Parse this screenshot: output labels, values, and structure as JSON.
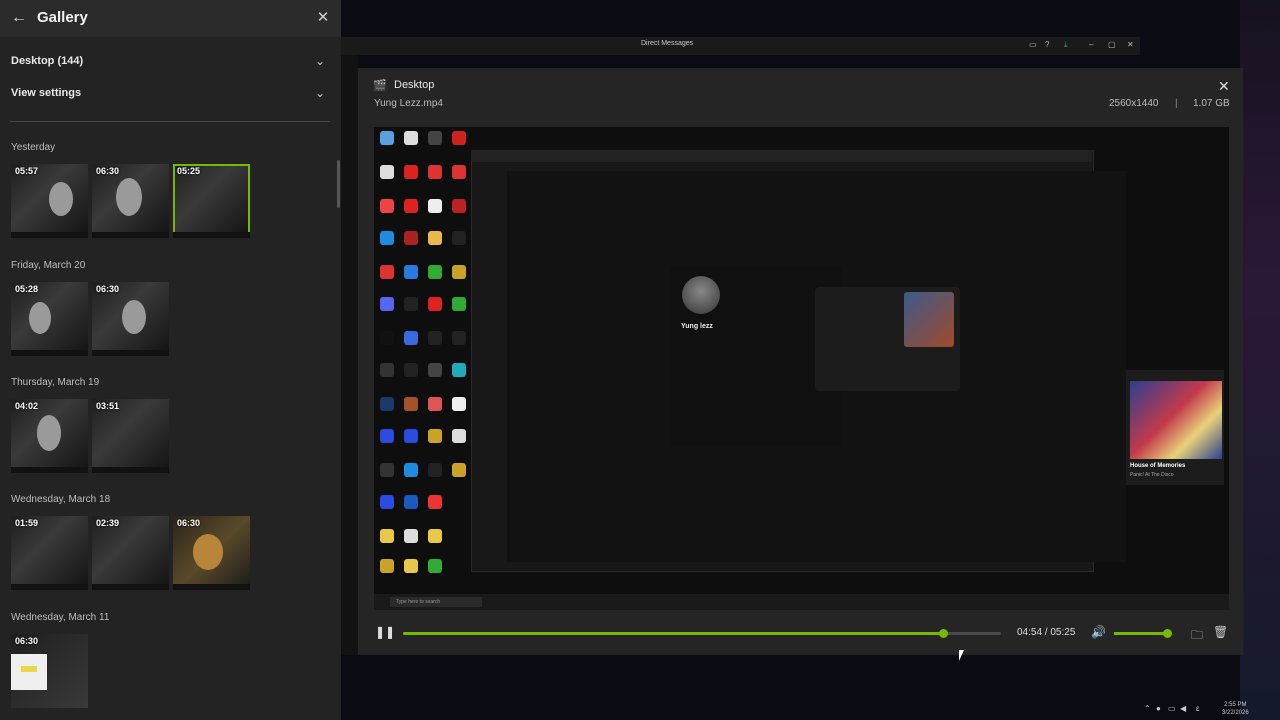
{
  "gallery": {
    "title": "Gallery",
    "source_dropdown": "Desktop (144)",
    "view_settings": "View settings",
    "groups": [
      {
        "date": "Yesterday",
        "items": [
          {
            "duration": "05:57"
          },
          {
            "duration": "06:30"
          },
          {
            "duration": "05:25",
            "selected": true
          }
        ]
      },
      {
        "date": "Friday, March 20",
        "items": [
          {
            "duration": "05:28"
          },
          {
            "duration": "06:30"
          }
        ]
      },
      {
        "date": "Thursday, March 19",
        "items": [
          {
            "duration": "04:02"
          },
          {
            "duration": "03:51"
          }
        ]
      },
      {
        "date": "Wednesday, March 18",
        "items": [
          {
            "duration": "01:59"
          },
          {
            "duration": "02:39"
          },
          {
            "duration": "06:30"
          }
        ]
      },
      {
        "date": "Wednesday, March 11",
        "items": [
          {
            "duration": "06:30"
          }
        ]
      }
    ]
  },
  "background_app": {
    "title": "Direct Messages"
  },
  "viewer": {
    "title": "Desktop",
    "filename": "Yung Lezz.mp4",
    "resolution": "2560x1440",
    "separator": "|",
    "file_size": "1.07 GB",
    "time_display": "04:54 / 05:25",
    "progress_fraction": 0.903,
    "volume_fraction": 1.0
  },
  "video_frame": {
    "profile_name": "Yung lezz",
    "popup_title": "House of Memories",
    "popup_artist": "Panic! At The Disco",
    "taskbar_search": "Type here to search"
  },
  "system_tray": {
    "time": "2:55 PM",
    "date": "3/22/2026"
  },
  "colors": {
    "accent": "#76b900",
    "panel": "#232323",
    "viewer": "#252525"
  }
}
